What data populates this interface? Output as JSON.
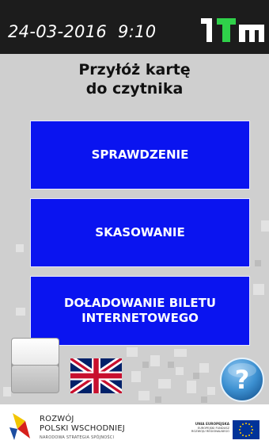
{
  "header": {
    "datetime": "24-03-2016  9:10",
    "logo": "LTM"
  },
  "main": {
    "prompt_line1": "Przyłóż kartę",
    "prompt_line2": "do czytnika",
    "buttons": [
      {
        "label": "SPRAWDZENIE"
      },
      {
        "label": "SKASOWANIE"
      },
      {
        "label_line1": "DOŁADOWANIE BILETU",
        "label_line2": "INTERNETOWEGO"
      }
    ],
    "languages": [
      {
        "code": "pl",
        "icon": "poland-flag-icon"
      },
      {
        "code": "en",
        "icon": "uk-flag-icon"
      }
    ],
    "help": {
      "icon": "help-icon",
      "glyph": "?"
    }
  },
  "footer": {
    "left_title_line1": "ROZWÓJ",
    "left_title_line2": "POLSKI WSCHODNIEJ",
    "left_subtitle": "NARODOWA STRATEGIA SPÓJNOŚCI",
    "eu_line1": "UNIA EUROPEJSKA",
    "eu_line2": "EUROPEJSKI FUNDUSZ",
    "eu_line3": "ROZWOJU REGIONALNEGO"
  },
  "colors": {
    "topbar": "#1c1c1c",
    "background": "#cfcfcf",
    "button": "#0a14f0",
    "logo_green": "#2fd14a",
    "help": "#3b8fd0"
  }
}
